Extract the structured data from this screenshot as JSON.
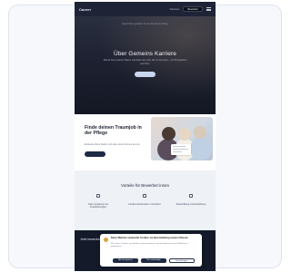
{
  "site": {
    "logo": "Career"
  },
  "nav": {
    "link": "Karriere",
    "button": "Bewerben"
  },
  "hero": {
    "tagline": "Gemeinsam gestalten wir die Zukunft der Pflege",
    "title": "Über Gemeins Karriere",
    "subtitle": "Werde Teil unseres Teams und finde den Job, der zu dir passt – mit Perspektive und Sinn."
  },
  "feature": {
    "title": "Finde deinen Traumjob in der Pflege",
    "text": "Entdecke offene Stellen und starte deine Karriere bei uns.",
    "button": ""
  },
  "benefits": {
    "title": "Vorteile für Bewerber:innen",
    "items": [
      {
        "label": "Faire Vergütung und Zusatzleistungen"
      },
      {
        "label": "Flexible Arbeitszeiten und Teilzeit"
      },
      {
        "label": "Weiterbildung und Entwicklung"
      }
    ]
  },
  "bottom": {
    "title": "Jetzt bewerben"
  },
  "cookie": {
    "title": "Diese Website verwendet Cookies zur Bereitstellung unserer Dienste",
    "text": "Wir nutzen Cookies, um Inhalte zu personalisieren und die Nutzung unserer Website zu analysieren.",
    "accept": "Alle akzeptieren",
    "necessary": "Nur notwendige",
    "settings": "Einstellungen"
  }
}
